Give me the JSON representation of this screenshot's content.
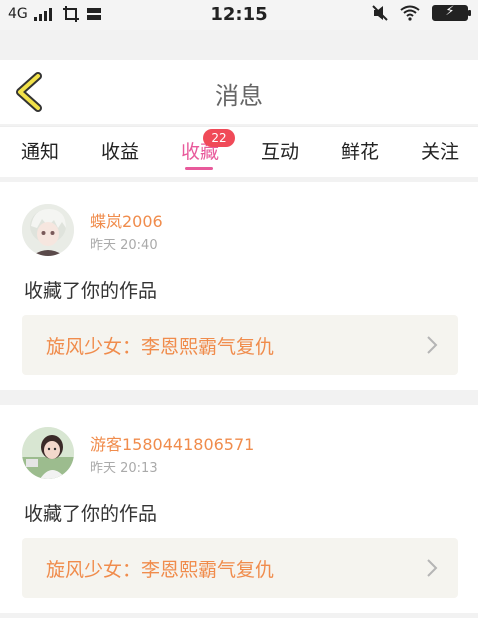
{
  "status_bar": {
    "network": "4G",
    "time": "12:15"
  },
  "header": {
    "title": "消息"
  },
  "tabs": [
    {
      "label": "通知"
    },
    {
      "label": "收益"
    },
    {
      "label": "收藏",
      "active": true,
      "badge": "22"
    },
    {
      "label": "互动"
    },
    {
      "label": "鲜花"
    },
    {
      "label": "关注"
    }
  ],
  "notifications": [
    {
      "username": "蝶岚2006",
      "time": "昨天 20:40",
      "message": "收藏了你的作品",
      "work_title": "旋风少女：李恩熙霸气复仇"
    },
    {
      "username": "游客1580441806571",
      "time": "昨天 20:13",
      "message": "收藏了你的作品",
      "work_title": "旋风少女：李恩熙霸气复仇"
    }
  ],
  "colors": {
    "accent": "#e85a9b",
    "badge": "#f04a58",
    "username": "#f08c4c",
    "back_icon": "#f2e24a"
  }
}
